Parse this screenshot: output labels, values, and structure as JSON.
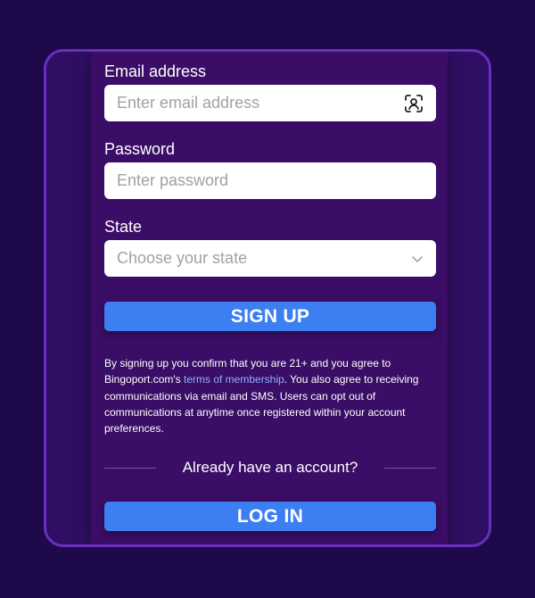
{
  "form": {
    "email": {
      "label": "Email address",
      "placeholder": "Enter email address",
      "icon": "face-id-icon"
    },
    "password": {
      "label": "Password",
      "placeholder": "Enter password"
    },
    "state": {
      "label": "State",
      "placeholder": "Choose your state",
      "icon": "chevron-down-icon"
    },
    "signup_label": "SIGN UP"
  },
  "legal": {
    "text_before": "By signing up you confirm that you are 21+ and you agree to Bingoport.com's ",
    "link_text": "terms of membership",
    "text_after": ". You also agree to receiving communications via email and SMS. Users can opt out of communications at anytime once registered within your account preferences."
  },
  "login": {
    "prompt": "Already have an account?",
    "button_label": "LOG IN"
  },
  "colors": {
    "background": "#1e0a4a",
    "panel": "#3a0d66",
    "frame_border": "#6a2fc0",
    "button": "#3b7ff2",
    "link": "#8fb2ff"
  }
}
